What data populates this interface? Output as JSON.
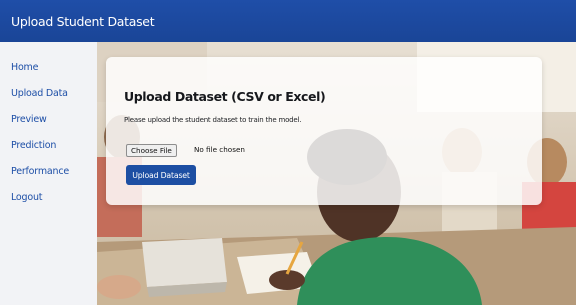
{
  "app": {
    "title": "Upload Student Dataset"
  },
  "sidebar": {
    "items": [
      {
        "label": "Home"
      },
      {
        "label": "Upload Data"
      },
      {
        "label": "Preview"
      },
      {
        "label": "Prediction"
      },
      {
        "label": "Performance"
      },
      {
        "label": "Logout"
      }
    ]
  },
  "upload_card": {
    "title": "Upload Dataset (CSV or Excel)",
    "description": "Please upload the student dataset to train the model.",
    "file_button_label": "Choose File",
    "file_status": "No file chosen",
    "submit_label": "Upload Dataset"
  },
  "colors": {
    "header": "#1f4ea8",
    "nav_link": "#1e4fa7",
    "primary_button": "#1d4fa3",
    "sidebar_bg": "#f2f3f6"
  }
}
